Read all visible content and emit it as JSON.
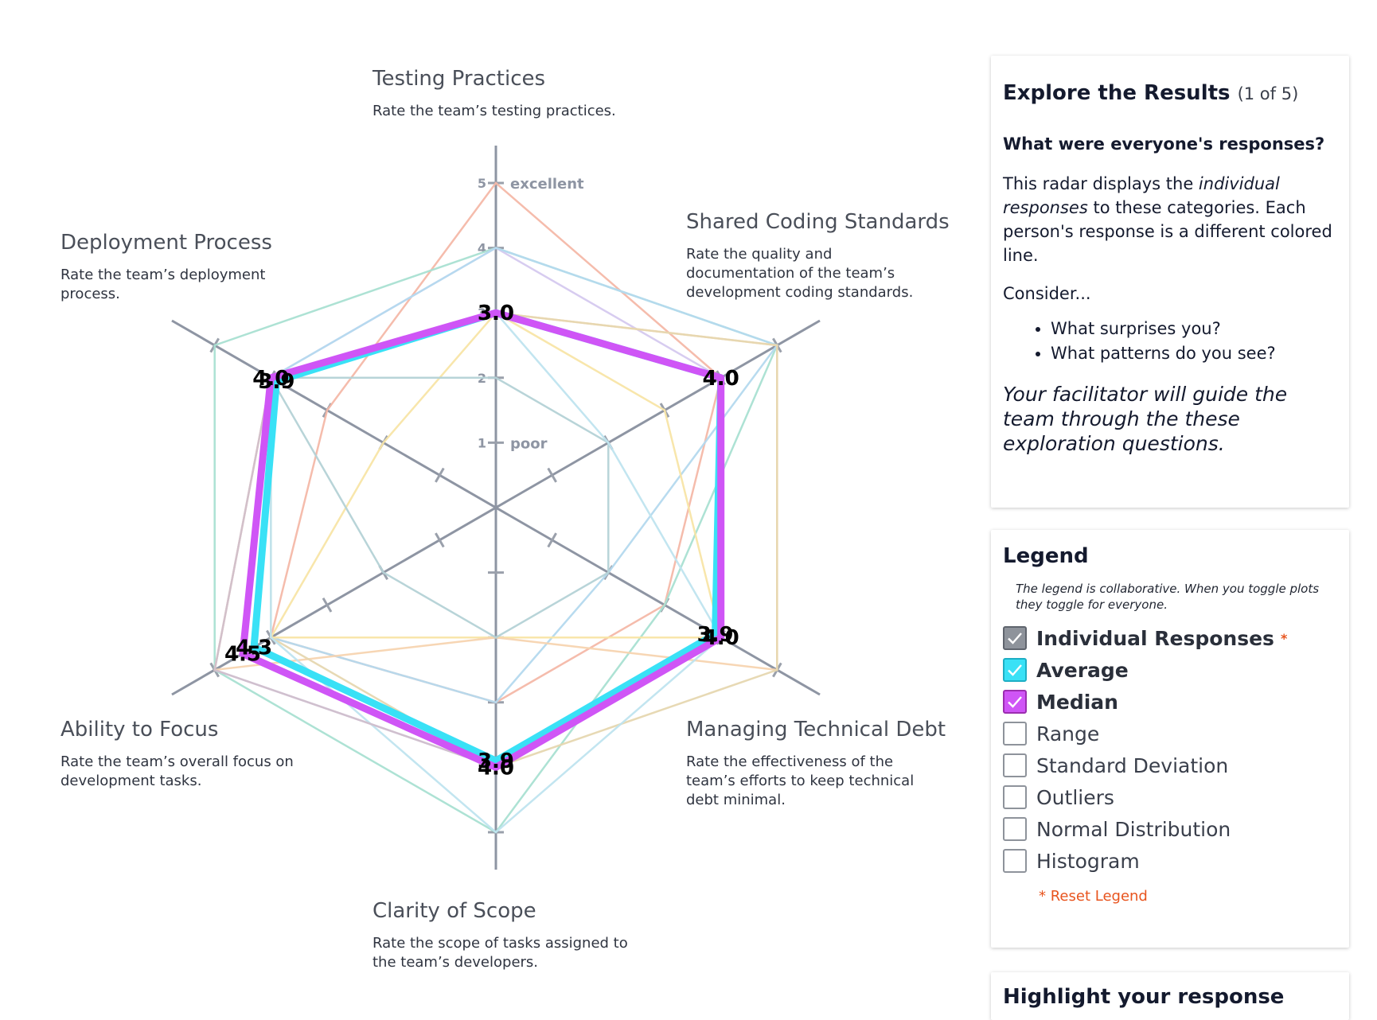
{
  "chart_data": {
    "type": "radar",
    "scale": {
      "min": 0,
      "max": 5,
      "ticks": [
        1,
        2,
        3,
        4,
        5
      ],
      "tick_labels": {
        "1": "poor",
        "5": "excellent"
      }
    },
    "categories": [
      {
        "title": "Testing Practices",
        "description": "Rate the team’s testing practices."
      },
      {
        "title": "Shared Coding Standards",
        "description": "Rate the quality and documentation of the team’s development coding standards."
      },
      {
        "title": "Managing Technical Debt",
        "description": "Rate the effectiveness of the team’s efforts to keep technical debt minimal."
      },
      {
        "title": "Clarity of Scope",
        "description": "Rate the scope of tasks assigned to the team’s developers."
      },
      {
        "title": "Ability to Focus",
        "description": "Rate the team’s overall focus on development tasks."
      },
      {
        "title": "Deployment Process",
        "description": "Rate the team’s deployment process."
      }
    ],
    "individual_series": [
      {
        "color": "#f4b8a8",
        "values": [
          5,
          4,
          3,
          3,
          4,
          3
        ]
      },
      {
        "color": "#a9e0d2",
        "values": [
          4,
          5,
          3,
          5,
          5,
          5
        ]
      },
      {
        "color": "#d5c9ef",
        "values": [
          4,
          4,
          4,
          4,
          5,
          4
        ]
      },
      {
        "color": "#b4d9ee",
        "values": [
          4,
          5,
          2,
          3,
          4,
          4
        ]
      },
      {
        "color": "#f8e5a6",
        "values": [
          3,
          3,
          4,
          2,
          4,
          2
        ]
      },
      {
        "color": "#f7d4b0",
        "values": [
          3,
          5,
          5,
          2,
          5,
          4
        ]
      },
      {
        "color": "#e6d7b0",
        "values": [
          3,
          5,
          5,
          4,
          4,
          4
        ]
      },
      {
        "color": "#b4d2d6",
        "values": [
          2,
          2,
          2,
          2,
          2,
          4
        ]
      },
      {
        "color": "#bfe4ef",
        "values": [
          3,
          2,
          4,
          5,
          4,
          4
        ]
      },
      {
        "color": "#d0bfcb",
        "values": [
          3,
          4,
          4,
          4,
          5,
          4
        ]
      }
    ],
    "average": {
      "name": "Average",
      "color": "#39e1f6",
      "values": [
        3.0,
        4.0,
        3.9,
        3.9,
        4.3,
        3.9
      ],
      "labels": [
        "3.0",
        "4.0",
        "3.9",
        "3.9",
        "4.3",
        "3.9"
      ]
    },
    "median": {
      "name": "Median",
      "color": "#cf55f6",
      "values": [
        3.0,
        4.0,
        4.0,
        4.0,
        4.5,
        4.0
      ],
      "labels": [
        "3.0",
        "4.0",
        "4.0",
        "4.0",
        "4.5",
        "4.0"
      ]
    }
  },
  "explore": {
    "title": "Explore the Results",
    "counter": "(1 of 5)",
    "question": "What were everyone's responses?",
    "p1_a": "This radar displays the ",
    "p1_em": "individual responses",
    "p1_b": " to these categories. Each person's response is a different colored line.",
    "consider": "Consider...",
    "bullets": [
      "What surprises you?",
      "What patterns do you see?"
    ],
    "facilitator": "Your facilitator will guide the team through the these exploration questions."
  },
  "legend": {
    "title": "Legend",
    "note": "The legend is collaborative. When you toggle plots they toggle for everyone.",
    "items": [
      {
        "label": "Individual Responses",
        "checked": true,
        "color": "#8e939b",
        "star": "*"
      },
      {
        "label": "Average",
        "checked": true,
        "color": "#39e1f6"
      },
      {
        "label": "Median",
        "checked": true,
        "color": "#cf55f6"
      },
      {
        "label": "Range",
        "checked": false
      },
      {
        "label": "Standard Deviation",
        "checked": false
      },
      {
        "label": "Outliers",
        "checked": false
      },
      {
        "label": "Normal Distribution",
        "checked": false
      },
      {
        "label": "Histogram",
        "checked": false
      }
    ],
    "reset": "* Reset Legend"
  },
  "highlight": {
    "title": "Highlight your response"
  }
}
